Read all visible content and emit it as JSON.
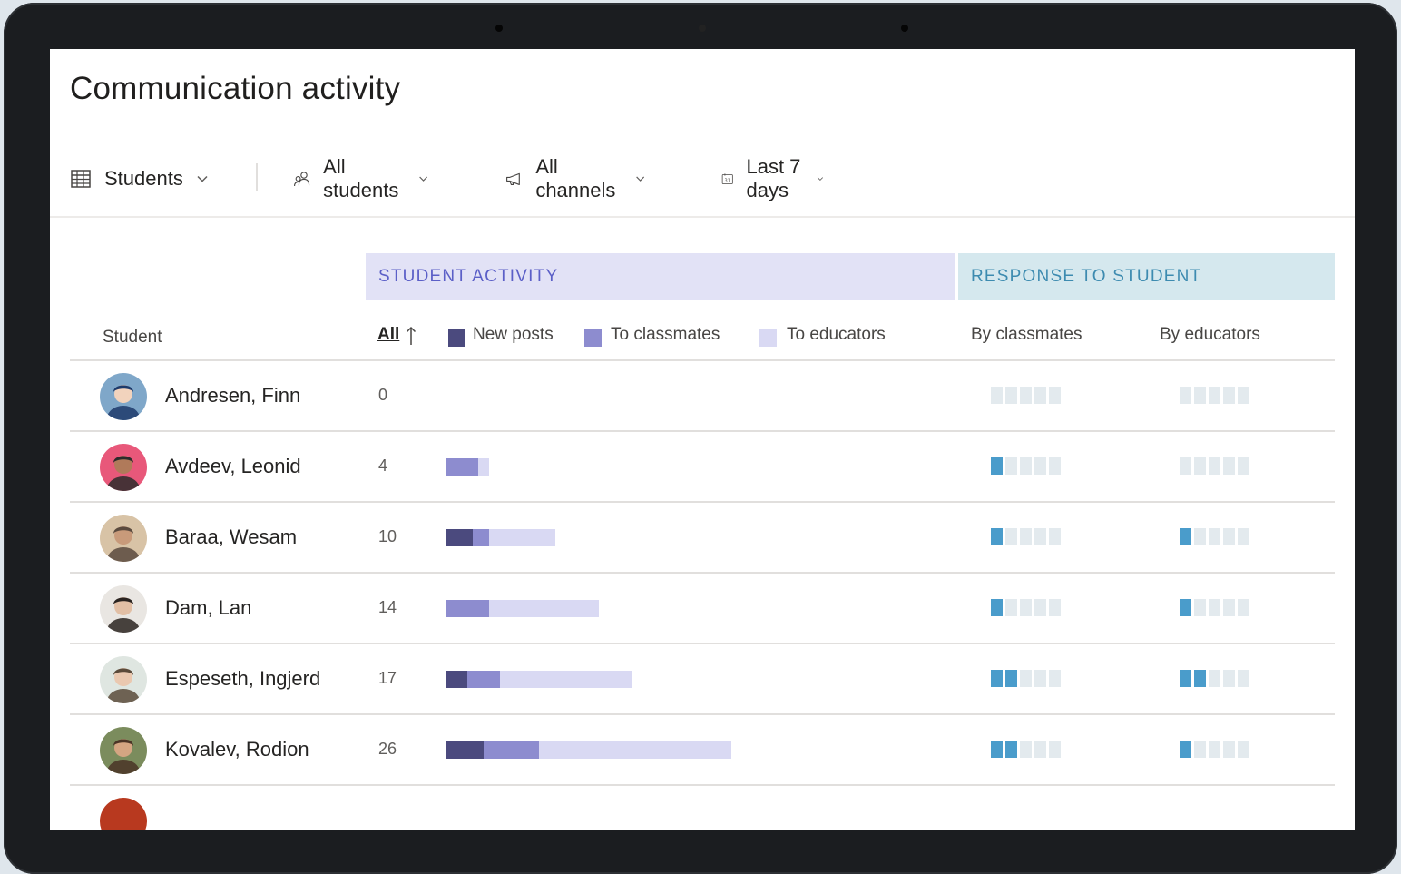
{
  "page": {
    "title": "Communication activity"
  },
  "filters": {
    "view": {
      "label": "Students",
      "icon": "grid-table-icon"
    },
    "students": {
      "label": "All students",
      "icon": "people-icon"
    },
    "channels": {
      "label": "All channels",
      "icon": "megaphone-icon"
    },
    "period": {
      "label": "Last 7 days",
      "icon": "calendar-icon"
    }
  },
  "groups": {
    "student_activity": "STUDENT ACTIVITY",
    "response_to_student": "RESPONSE TO STUDENT"
  },
  "columns": {
    "student": "Student",
    "all": "All",
    "new_posts": "New posts",
    "to_classmates": "To classmates",
    "to_educators": "To educators",
    "by_classmates": "By classmates",
    "by_educators": "By educators"
  },
  "colors": {
    "new_posts": "#4b4a7e",
    "to_classmates": "#8d8ccf",
    "to_educators": "#d9d9f3",
    "pip_on": "#4a9ccb",
    "pip_off": "#e3eaee"
  },
  "rows": [
    {
      "name": "Andresen, Finn",
      "total": "0",
      "new_posts": 0,
      "to_classmates": 0,
      "to_educators": 0,
      "by_classmates": 0,
      "by_educators": 0
    },
    {
      "name": "Avdeev, Leonid",
      "total": "4",
      "new_posts": 0,
      "to_classmates": 3,
      "to_educators": 1,
      "by_classmates": 1,
      "by_educators": 0
    },
    {
      "name": "Baraa, Wesam",
      "total": "10",
      "new_posts": 2.5,
      "to_classmates": 1.5,
      "to_educators": 6,
      "by_classmates": 1,
      "by_educators": 1
    },
    {
      "name": "Dam, Lan",
      "total": "14",
      "new_posts": 0,
      "to_classmates": 4,
      "to_educators": 10,
      "by_classmates": 1,
      "by_educators": 1
    },
    {
      "name": "Espeseth, Ingjerd",
      "total": "17",
      "new_posts": 2,
      "to_classmates": 3,
      "to_educators": 12,
      "by_classmates": 2,
      "by_educators": 2
    },
    {
      "name": "Kovalev, Rodion",
      "total": "26",
      "new_posts": 3.5,
      "to_classmates": 5,
      "to_educators": 17.5,
      "by_classmates": 2,
      "by_educators": 1
    }
  ]
}
